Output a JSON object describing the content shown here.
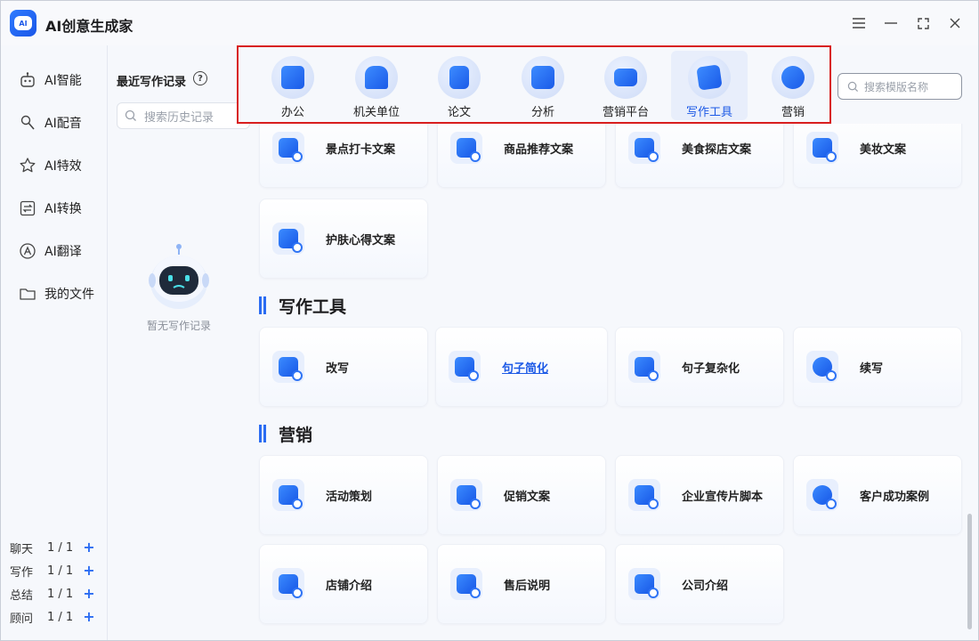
{
  "app": {
    "title": "AI创意生成家",
    "logo_text": "AI"
  },
  "window_controls": [
    "menu-icon",
    "minimize-icon",
    "maximize-icon",
    "close-icon"
  ],
  "nav": {
    "items": [
      {
        "label": "AI智能",
        "icon": "robot-icon"
      },
      {
        "label": "AI配音",
        "icon": "microphone-icon"
      },
      {
        "label": "AI特效",
        "icon": "star-icon"
      },
      {
        "label": "AI转换",
        "icon": "convert-icon"
      },
      {
        "label": "AI翻译",
        "icon": "translate-icon"
      },
      {
        "label": "我的文件",
        "icon": "folder-icon"
      }
    ],
    "counts": [
      {
        "label": "聊天",
        "value": "1 / 1"
      },
      {
        "label": "写作",
        "value": "1 / 1"
      },
      {
        "label": "总结",
        "value": "1 / 1"
      },
      {
        "label": "顾问",
        "value": "1 / 1"
      }
    ]
  },
  "history": {
    "title": "最近写作记录",
    "search_placeholder": "搜索历史记录",
    "empty_text": "暂无写作记录"
  },
  "categories": [
    {
      "label": "办公",
      "icon": "briefcase-icon"
    },
    {
      "label": "机关单位",
      "icon": "building-icon"
    },
    {
      "label": "论文",
      "icon": "document-icon"
    },
    {
      "label": "分析",
      "icon": "chart-icon"
    },
    {
      "label": "营销平台",
      "icon": "billboard-icon"
    },
    {
      "label": "写作工具",
      "icon": "edit-icon",
      "active": true
    },
    {
      "label": "营销",
      "icon": "target-icon"
    }
  ],
  "template_search": {
    "placeholder": "搜索模版名称"
  },
  "sections": {
    "top_cards": [
      {
        "label": "景点打卡文案"
      },
      {
        "label": "商品推荐文案"
      },
      {
        "label": "美食探店文案"
      },
      {
        "label": "美妆文案"
      },
      {
        "label": "护肤心得文案"
      }
    ],
    "writing_tools": {
      "title": "写作工具",
      "cards": [
        {
          "label": "改写"
        },
        {
          "label": "句子简化"
        },
        {
          "label": "句子复杂化"
        },
        {
          "label": "续写"
        }
      ]
    },
    "marketing": {
      "title": "营销",
      "cards": [
        {
          "label": "活动策划"
        },
        {
          "label": "促销文案"
        },
        {
          "label": "企业宣传片脚本"
        },
        {
          "label": "客户成功案例"
        },
        {
          "label": "店铺介绍"
        },
        {
          "label": "售后说明"
        },
        {
          "label": "公司介绍"
        }
      ]
    }
  },
  "colors": {
    "accent": "#2b6cf2",
    "highlight_border": "#d81e1e"
  }
}
